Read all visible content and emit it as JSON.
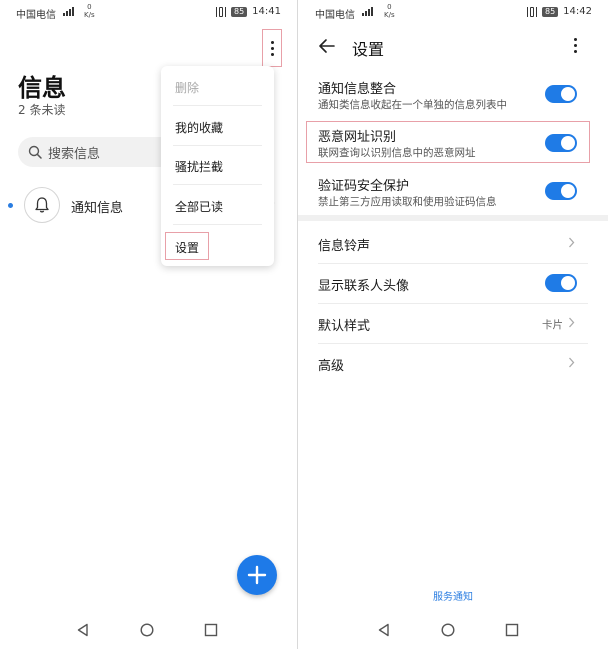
{
  "left_screen": {
    "status": {
      "carrier": "中国电信",
      "speed_value": "0",
      "speed_unit": "K/s",
      "battery": "85",
      "time": "14:41"
    },
    "title": "信息",
    "unread": "2 条未读",
    "search_placeholder": "搜索信息",
    "conversation": {
      "name": "通知信息"
    },
    "menu": {
      "items": [
        {
          "label": "删除",
          "enabled": false
        },
        {
          "label": "我的收藏",
          "enabled": true
        },
        {
          "label": "骚扰拦截",
          "enabled": true
        },
        {
          "label": "全部已读",
          "enabled": true
        },
        {
          "label": "设置",
          "enabled": true
        }
      ]
    },
    "icons": {
      "menu": "more-vert-icon",
      "search": "search-icon",
      "avatar": "bell-icon",
      "fab": "plus-icon"
    }
  },
  "right_screen": {
    "status": {
      "carrier": "中国电信",
      "speed_value": "0",
      "speed_unit": "K/s",
      "battery": "85",
      "time": "14:42"
    },
    "title": "设置",
    "settings": [
      {
        "title": "通知信息整合",
        "subtitle": "通知类信息收起在一个单独的信息列表中",
        "enabled": true
      },
      {
        "title": "恶意网址识别",
        "subtitle": "联网查询以识别信息中的恶意网址",
        "enabled": true
      },
      {
        "title": "验证码安全保护",
        "subtitle": "禁止第三方应用读取和使用验证码信息",
        "enabled": true
      }
    ],
    "options": [
      {
        "title": "信息铃声",
        "value": ""
      },
      {
        "title": "显示联系人头像",
        "enabled": true
      },
      {
        "title": "默认样式",
        "value": "卡片"
      },
      {
        "title": "高级",
        "value": ""
      }
    ],
    "service_link": "服务通知"
  },
  "colors": {
    "accent": "#1f7be6",
    "highlight_box": "#e8a0a8"
  }
}
